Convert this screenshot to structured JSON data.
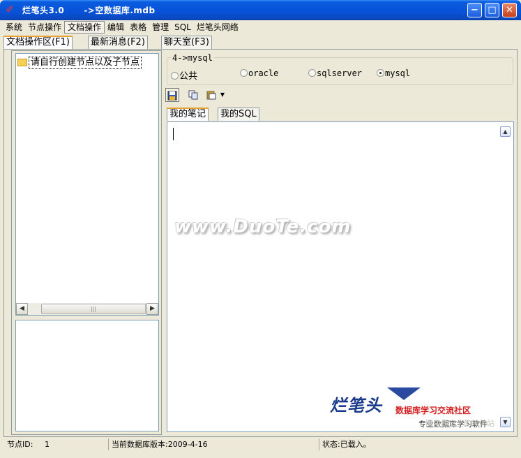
{
  "window": {
    "title": "烂笔头3.0      ->空数据库.mdb"
  },
  "menubar": {
    "items": [
      "系统",
      "节点操作",
      "文档操作",
      "编辑",
      "表格",
      "管理",
      "SQL",
      "烂笔头网络"
    ]
  },
  "main_tabs": [
    "文档操作区(F1)",
    "最新消息(F2)",
    "聊天室(F3)"
  ],
  "tree": {
    "root_label": "请自行创建节点以及子节点"
  },
  "db_group": {
    "title": "4->mysql",
    "options": [
      "公共",
      "oracle",
      "sqlserver",
      "mysql"
    ],
    "selected": "mysql"
  },
  "toolbar": {
    "icons": [
      "save-icon",
      "copy-icon",
      "paste-icon",
      "dropdown-arrow-icon"
    ]
  },
  "sub_tabs": [
    "我的笔记",
    "我的SQL"
  ],
  "editor": {
    "content": ""
  },
  "watermark": "www.DuoTe.com",
  "banner": {
    "logo": "烂笔头",
    "slogan": "数据库学习交流社区",
    "subtitle": "专业数据库学习软件"
  },
  "corner_watermark": "国内最安全的软件站",
  "status": {
    "node_id_label": "节点ID:",
    "node_id": "1",
    "db_version": "当前数据库版本:2009-4-16",
    "state": "状态:已载入。"
  }
}
